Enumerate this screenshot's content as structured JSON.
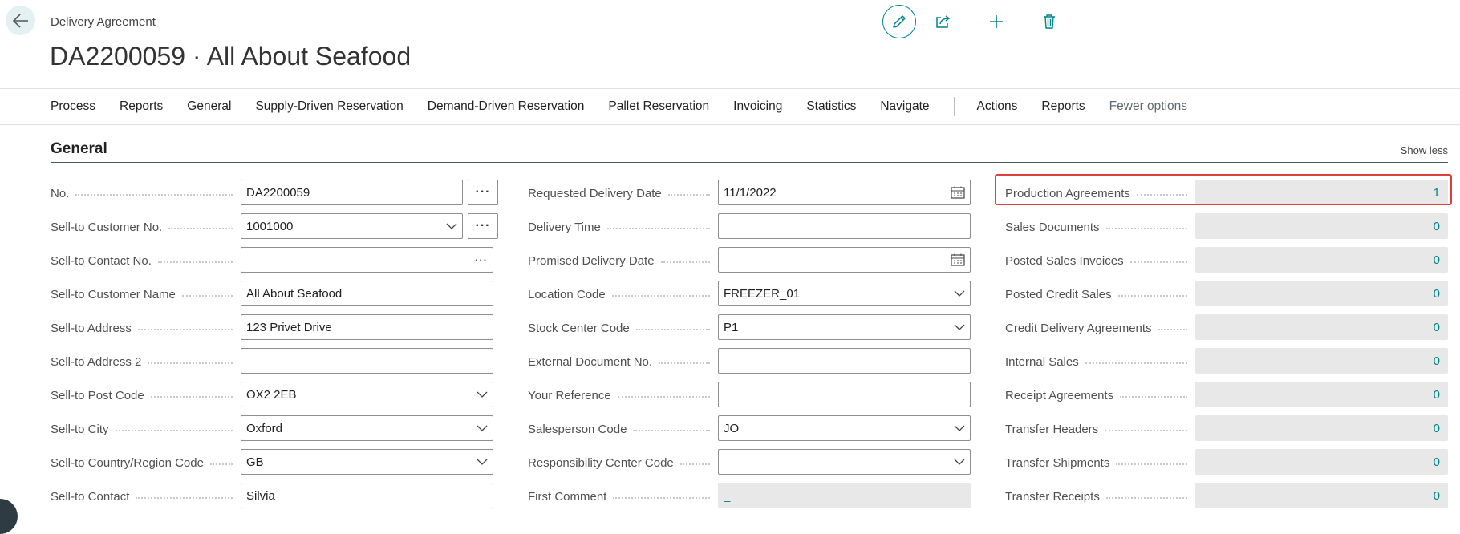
{
  "header": {
    "page_type": "Delivery Agreement",
    "title": "DA2200059 · All About Seafood",
    "icons": [
      "back-arrow-icon",
      "edit-pencil-icon",
      "share-icon",
      "plus-icon",
      "delete-icon"
    ]
  },
  "action_bar": {
    "items": [
      "Process",
      "Reports",
      "General",
      "Supply-Driven Reservation",
      "Demand-Driven Reservation",
      "Pallet Reservation",
      "Invoicing",
      "Statistics",
      "Navigate"
    ],
    "secondary": [
      "Actions",
      "Reports"
    ],
    "fewer_options": "Fewer options"
  },
  "section": {
    "title": "General",
    "show_less": "Show less"
  },
  "col1": [
    {
      "label": "No.",
      "value": "DA2200059",
      "type": "text-ellipsis"
    },
    {
      "label": "Sell-to Customer No.",
      "value": "1001000",
      "type": "dropdown-ellipsis"
    },
    {
      "label": "Sell-to Contact No.",
      "value": "",
      "type": "inline-ellipsis",
      "ellipsis": "···"
    },
    {
      "label": "Sell-to Customer Name",
      "value": "All About Seafood",
      "type": "text"
    },
    {
      "label": "Sell-to Address",
      "value": "123 Privet Drive",
      "type": "text"
    },
    {
      "label": "Sell-to Address 2",
      "value": "",
      "type": "text"
    },
    {
      "label": "Sell-to Post Code",
      "value": "OX2 2EB",
      "type": "dropdown"
    },
    {
      "label": "Sell-to City",
      "value": "Oxford",
      "type": "dropdown"
    },
    {
      "label": "Sell-to Country/Region Code",
      "value": "GB",
      "type": "dropdown"
    },
    {
      "label": "Sell-to Contact",
      "value": "Silvia",
      "type": "text"
    }
  ],
  "col2": [
    {
      "label": "Requested Delivery Date",
      "value": "11/1/2022",
      "type": "date"
    },
    {
      "label": "Delivery Time",
      "value": "",
      "type": "text"
    },
    {
      "label": "Promised Delivery Date",
      "value": "",
      "type": "date"
    },
    {
      "label": "Location Code",
      "value": "FREEZER_01",
      "type": "dropdown"
    },
    {
      "label": "Stock Center Code",
      "value": "P1",
      "type": "dropdown"
    },
    {
      "label": "External Document No.",
      "value": "",
      "type": "text"
    },
    {
      "label": "Your Reference",
      "value": "",
      "type": "text"
    },
    {
      "label": "Salesperson Code",
      "value": "JO",
      "type": "dropdown"
    },
    {
      "label": "Responsibility Center Code",
      "value": "",
      "type": "dropdown"
    },
    {
      "label": "First Comment",
      "value": "_",
      "type": "readonly"
    }
  ],
  "col3": [
    {
      "label": "Production Agreements",
      "value": "1"
    },
    {
      "label": "Sales Documents",
      "value": "0"
    },
    {
      "label": "Posted Sales Invoices",
      "value": "0"
    },
    {
      "label": "Posted Credit Sales",
      "value": "0"
    },
    {
      "label": "Credit Delivery Agreements",
      "value": "0"
    },
    {
      "label": "Internal Sales",
      "value": "0"
    },
    {
      "label": "Receipt Agreements",
      "value": "0"
    },
    {
      "label": "Transfer Headers",
      "value": "0"
    },
    {
      "label": "Transfer Shipments",
      "value": "0"
    },
    {
      "label": "Transfer Receipts",
      "value": "0"
    }
  ],
  "colors": {
    "accent": "#008489",
    "highlight": "#e0403a",
    "readonly_bg": "#e8e8e8"
  }
}
